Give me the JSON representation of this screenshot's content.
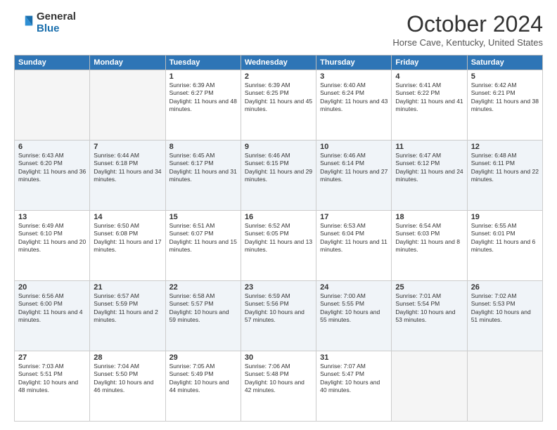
{
  "logo": {
    "general": "General",
    "blue": "Blue"
  },
  "title": "October 2024",
  "location": "Horse Cave, Kentucky, United States",
  "days_of_week": [
    "Sunday",
    "Monday",
    "Tuesday",
    "Wednesday",
    "Thursday",
    "Friday",
    "Saturday"
  ],
  "weeks": [
    [
      {
        "day": "",
        "empty": true
      },
      {
        "day": "",
        "empty": true
      },
      {
        "day": "1",
        "sunrise": "Sunrise: 6:39 AM",
        "sunset": "Sunset: 6:27 PM",
        "daylight": "Daylight: 11 hours and 48 minutes."
      },
      {
        "day": "2",
        "sunrise": "Sunrise: 6:39 AM",
        "sunset": "Sunset: 6:25 PM",
        "daylight": "Daylight: 11 hours and 45 minutes."
      },
      {
        "day": "3",
        "sunrise": "Sunrise: 6:40 AM",
        "sunset": "Sunset: 6:24 PM",
        "daylight": "Daylight: 11 hours and 43 minutes."
      },
      {
        "day": "4",
        "sunrise": "Sunrise: 6:41 AM",
        "sunset": "Sunset: 6:22 PM",
        "daylight": "Daylight: 11 hours and 41 minutes."
      },
      {
        "day": "5",
        "sunrise": "Sunrise: 6:42 AM",
        "sunset": "Sunset: 6:21 PM",
        "daylight": "Daylight: 11 hours and 38 minutes."
      }
    ],
    [
      {
        "day": "6",
        "sunrise": "Sunrise: 6:43 AM",
        "sunset": "Sunset: 6:20 PM",
        "daylight": "Daylight: 11 hours and 36 minutes."
      },
      {
        "day": "7",
        "sunrise": "Sunrise: 6:44 AM",
        "sunset": "Sunset: 6:18 PM",
        "daylight": "Daylight: 11 hours and 34 minutes."
      },
      {
        "day": "8",
        "sunrise": "Sunrise: 6:45 AM",
        "sunset": "Sunset: 6:17 PM",
        "daylight": "Daylight: 11 hours and 31 minutes."
      },
      {
        "day": "9",
        "sunrise": "Sunrise: 6:46 AM",
        "sunset": "Sunset: 6:15 PM",
        "daylight": "Daylight: 11 hours and 29 minutes."
      },
      {
        "day": "10",
        "sunrise": "Sunrise: 6:46 AM",
        "sunset": "Sunset: 6:14 PM",
        "daylight": "Daylight: 11 hours and 27 minutes."
      },
      {
        "day": "11",
        "sunrise": "Sunrise: 6:47 AM",
        "sunset": "Sunset: 6:12 PM",
        "daylight": "Daylight: 11 hours and 24 minutes."
      },
      {
        "day": "12",
        "sunrise": "Sunrise: 6:48 AM",
        "sunset": "Sunset: 6:11 PM",
        "daylight": "Daylight: 11 hours and 22 minutes."
      }
    ],
    [
      {
        "day": "13",
        "sunrise": "Sunrise: 6:49 AM",
        "sunset": "Sunset: 6:10 PM",
        "daylight": "Daylight: 11 hours and 20 minutes."
      },
      {
        "day": "14",
        "sunrise": "Sunrise: 6:50 AM",
        "sunset": "Sunset: 6:08 PM",
        "daylight": "Daylight: 11 hours and 17 minutes."
      },
      {
        "day": "15",
        "sunrise": "Sunrise: 6:51 AM",
        "sunset": "Sunset: 6:07 PM",
        "daylight": "Daylight: 11 hours and 15 minutes."
      },
      {
        "day": "16",
        "sunrise": "Sunrise: 6:52 AM",
        "sunset": "Sunset: 6:05 PM",
        "daylight": "Daylight: 11 hours and 13 minutes."
      },
      {
        "day": "17",
        "sunrise": "Sunrise: 6:53 AM",
        "sunset": "Sunset: 6:04 PM",
        "daylight": "Daylight: 11 hours and 11 minutes."
      },
      {
        "day": "18",
        "sunrise": "Sunrise: 6:54 AM",
        "sunset": "Sunset: 6:03 PM",
        "daylight": "Daylight: 11 hours and 8 minutes."
      },
      {
        "day": "19",
        "sunrise": "Sunrise: 6:55 AM",
        "sunset": "Sunset: 6:01 PM",
        "daylight": "Daylight: 11 hours and 6 minutes."
      }
    ],
    [
      {
        "day": "20",
        "sunrise": "Sunrise: 6:56 AM",
        "sunset": "Sunset: 6:00 PM",
        "daylight": "Daylight: 11 hours and 4 minutes."
      },
      {
        "day": "21",
        "sunrise": "Sunrise: 6:57 AM",
        "sunset": "Sunset: 5:59 PM",
        "daylight": "Daylight: 11 hours and 2 minutes."
      },
      {
        "day": "22",
        "sunrise": "Sunrise: 6:58 AM",
        "sunset": "Sunset: 5:57 PM",
        "daylight": "Daylight: 10 hours and 59 minutes."
      },
      {
        "day": "23",
        "sunrise": "Sunrise: 6:59 AM",
        "sunset": "Sunset: 5:56 PM",
        "daylight": "Daylight: 10 hours and 57 minutes."
      },
      {
        "day": "24",
        "sunrise": "Sunrise: 7:00 AM",
        "sunset": "Sunset: 5:55 PM",
        "daylight": "Daylight: 10 hours and 55 minutes."
      },
      {
        "day": "25",
        "sunrise": "Sunrise: 7:01 AM",
        "sunset": "Sunset: 5:54 PM",
        "daylight": "Daylight: 10 hours and 53 minutes."
      },
      {
        "day": "26",
        "sunrise": "Sunrise: 7:02 AM",
        "sunset": "Sunset: 5:53 PM",
        "daylight": "Daylight: 10 hours and 51 minutes."
      }
    ],
    [
      {
        "day": "27",
        "sunrise": "Sunrise: 7:03 AM",
        "sunset": "Sunset: 5:51 PM",
        "daylight": "Daylight: 10 hours and 48 minutes."
      },
      {
        "day": "28",
        "sunrise": "Sunrise: 7:04 AM",
        "sunset": "Sunset: 5:50 PM",
        "daylight": "Daylight: 10 hours and 46 minutes."
      },
      {
        "day": "29",
        "sunrise": "Sunrise: 7:05 AM",
        "sunset": "Sunset: 5:49 PM",
        "daylight": "Daylight: 10 hours and 44 minutes."
      },
      {
        "day": "30",
        "sunrise": "Sunrise: 7:06 AM",
        "sunset": "Sunset: 5:48 PM",
        "daylight": "Daylight: 10 hours and 42 minutes."
      },
      {
        "day": "31",
        "sunrise": "Sunrise: 7:07 AM",
        "sunset": "Sunset: 5:47 PM",
        "daylight": "Daylight: 10 hours and 40 minutes."
      },
      {
        "day": "",
        "empty": true
      },
      {
        "day": "",
        "empty": true
      }
    ]
  ]
}
